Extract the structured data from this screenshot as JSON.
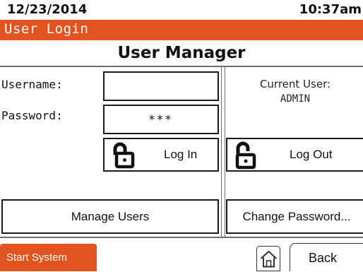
{
  "status_bar": {
    "date": "12/23/2014",
    "time": "10:37am"
  },
  "screen_header": {
    "title": "User Login"
  },
  "page": {
    "title": "User Manager"
  },
  "login": {
    "username_label": "Username:",
    "username_value": "",
    "password_label": "Password:",
    "password_value": "***",
    "login_button": "Log In",
    "login_icon": "lock-icon"
  },
  "current_user": {
    "label": "Current User:",
    "value": "ADMIN",
    "logout_button": "Log Out",
    "logout_icon": "unlock-icon"
  },
  "actions": {
    "manage_users": "Manage Users",
    "change_password": "Change Password..."
  },
  "footer": {
    "start_system": "Start System",
    "home_icon": "home-icon",
    "back": "Back"
  },
  "colors": {
    "accent": "#e2531f",
    "border": "#1c1c1c",
    "divider": "#6e6e6e"
  }
}
